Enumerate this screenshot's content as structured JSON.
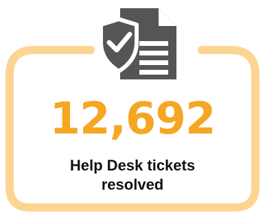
{
  "stat": {
    "value": "12,692",
    "label": "Help Desk tickets resolved"
  },
  "icon": {
    "name": "security-document-icon",
    "color": "#555555"
  },
  "colors": {
    "accent": "#f5a623",
    "frame": "#fdd592",
    "text": "#111111"
  }
}
